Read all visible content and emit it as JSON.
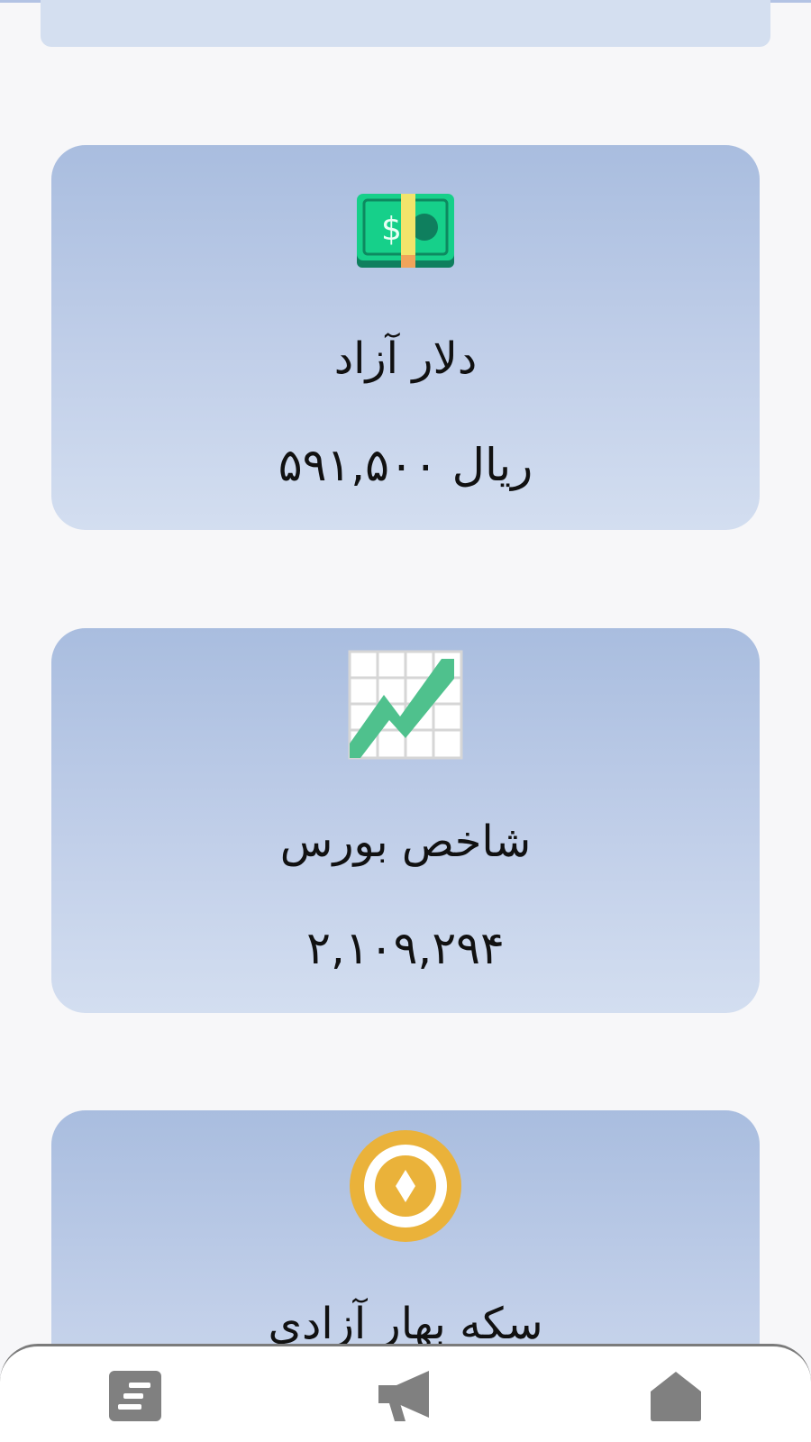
{
  "cards": [
    {
      "icon": "cash-icon",
      "title": "دلار آزاد",
      "value": "ریال ۵۹۱,۵۰۰"
    },
    {
      "icon": "chart-increasing-icon",
      "title": "شاخص بورس",
      "value": "۲,۱۰۹,۲۹۴"
    },
    {
      "icon": "coin-icon",
      "title": "سکه بهار آزادی"
    }
  ],
  "nav": [
    {
      "icon": "list-icon"
    },
    {
      "icon": "megaphone-icon"
    },
    {
      "icon": "home-icon"
    }
  ],
  "colors": {
    "card_top": "#a9bddf",
    "card_bottom": "#d3def0",
    "nav_icon": "#7f7f7f",
    "coin_gold": "#eab23a",
    "chart_green": "#4fc18d"
  }
}
